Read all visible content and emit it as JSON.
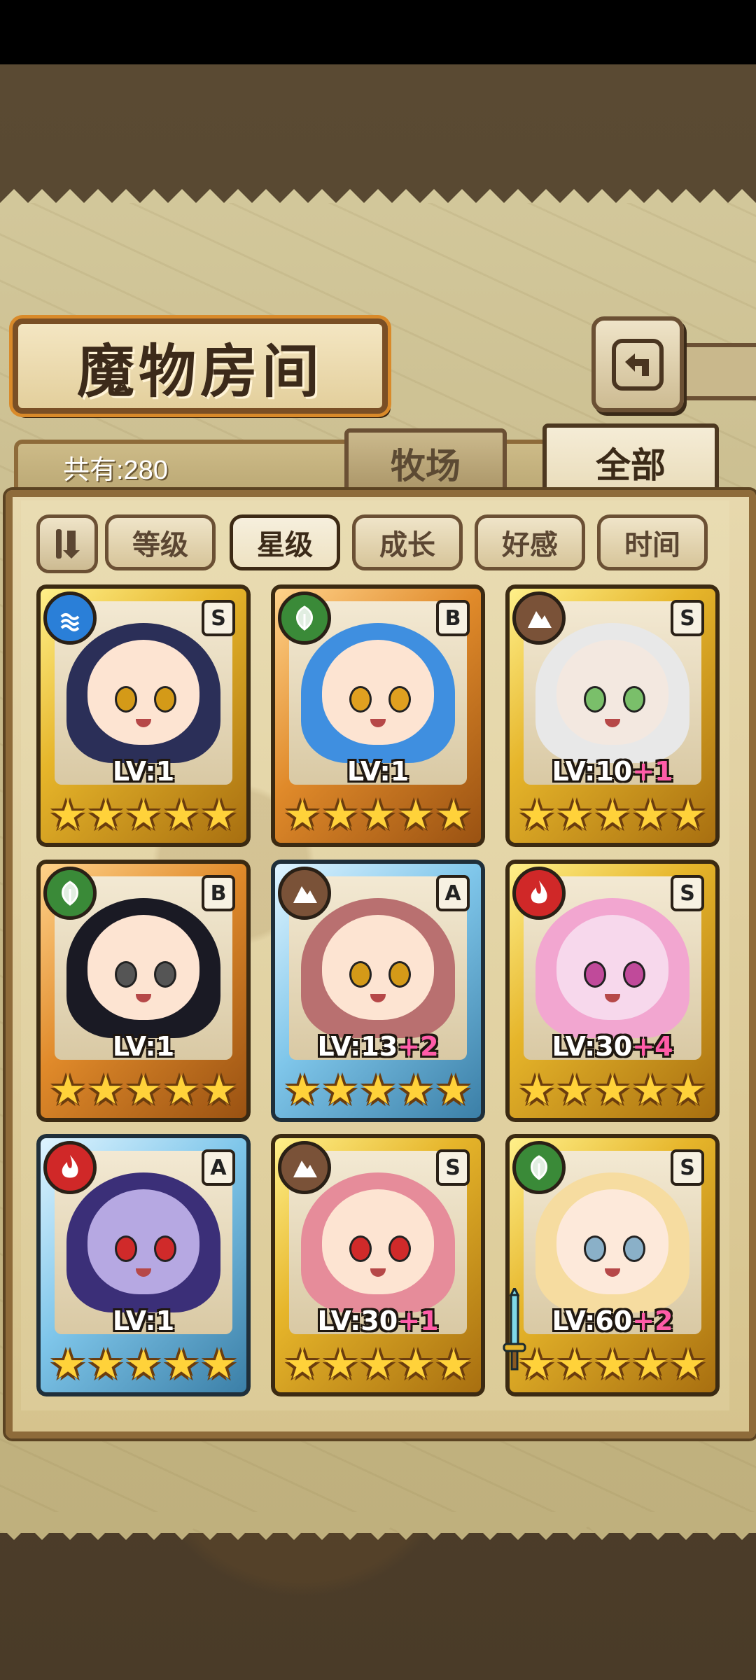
{
  "header": {
    "title": "魔物房间",
    "count_label": "共有:280"
  },
  "tabs": [
    {
      "label": "牧场",
      "active": false
    },
    {
      "label": "全部",
      "active": true
    }
  ],
  "sort": {
    "buttons": [
      {
        "label": "等级",
        "active": false
      },
      {
        "label": "星级",
        "active": true
      },
      {
        "label": "成长",
        "active": false
      },
      {
        "label": "好感",
        "active": false
      },
      {
        "label": "时间",
        "active": false
      }
    ]
  },
  "cards": [
    {
      "element": "water",
      "rank": "S",
      "level": "LV:1",
      "plus": "",
      "stars": 5,
      "frame": "gold",
      "hair": "#2b2f58",
      "skin": "#fde4d2",
      "eye": "#d49a18"
    },
    {
      "element": "wood",
      "rank": "B",
      "level": "LV:1",
      "plus": "",
      "stars": 5,
      "frame": "bronze",
      "hair": "#3f8fe0",
      "skin": "#fde4d2",
      "eye": "#e0a020"
    },
    {
      "element": "earth",
      "rank": "S",
      "level": "LV:10",
      "plus": "+1",
      "stars": 5,
      "frame": "gold",
      "hair": "#e8e8e8",
      "skin": "#f3e8e0",
      "eye": "#7abf6a"
    },
    {
      "element": "wood",
      "rank": "B",
      "level": "LV:1",
      "plus": "",
      "stars": 5,
      "frame": "bronze",
      "hair": "#1a1a24",
      "skin": "#fde4d2",
      "eye": "#555"
    },
    {
      "element": "earth",
      "rank": "A",
      "level": "LV:13",
      "plus": "+2",
      "stars": 5,
      "frame": "blue",
      "hair": "#b97070",
      "skin": "#fde4d2",
      "eye": "#d49a18"
    },
    {
      "element": "fire",
      "rank": "S",
      "level": "LV:30",
      "plus": "+4",
      "stars": 5,
      "frame": "gold",
      "hair": "#f2a6d0",
      "skin": "#f7d8ec",
      "eye": "#c04a9a"
    },
    {
      "element": "fire",
      "rank": "A",
      "level": "LV:1",
      "plus": "",
      "stars": 5,
      "frame": "blue",
      "hair": "#3b2f78",
      "skin": "#b6a8e2",
      "eye": "#d02a2a"
    },
    {
      "element": "earth",
      "rank": "S",
      "level": "LV:30",
      "plus": "+1",
      "stars": 5,
      "frame": "gold",
      "hair": "#e68c9a",
      "skin": "#fde4d2",
      "eye": "#d02a2a"
    },
    {
      "element": "wood",
      "rank": "S",
      "level": "LV:60",
      "plus": "+2",
      "stars": 5,
      "frame": "gold",
      "hair": "#f6dca0",
      "skin": "#fde9da",
      "eye": "#8ab0c8"
    }
  ],
  "colors": {
    "water": "#2a7fd8",
    "wood": "#3a8a38",
    "earth": "#7a5238",
    "fire": "#d02828"
  }
}
